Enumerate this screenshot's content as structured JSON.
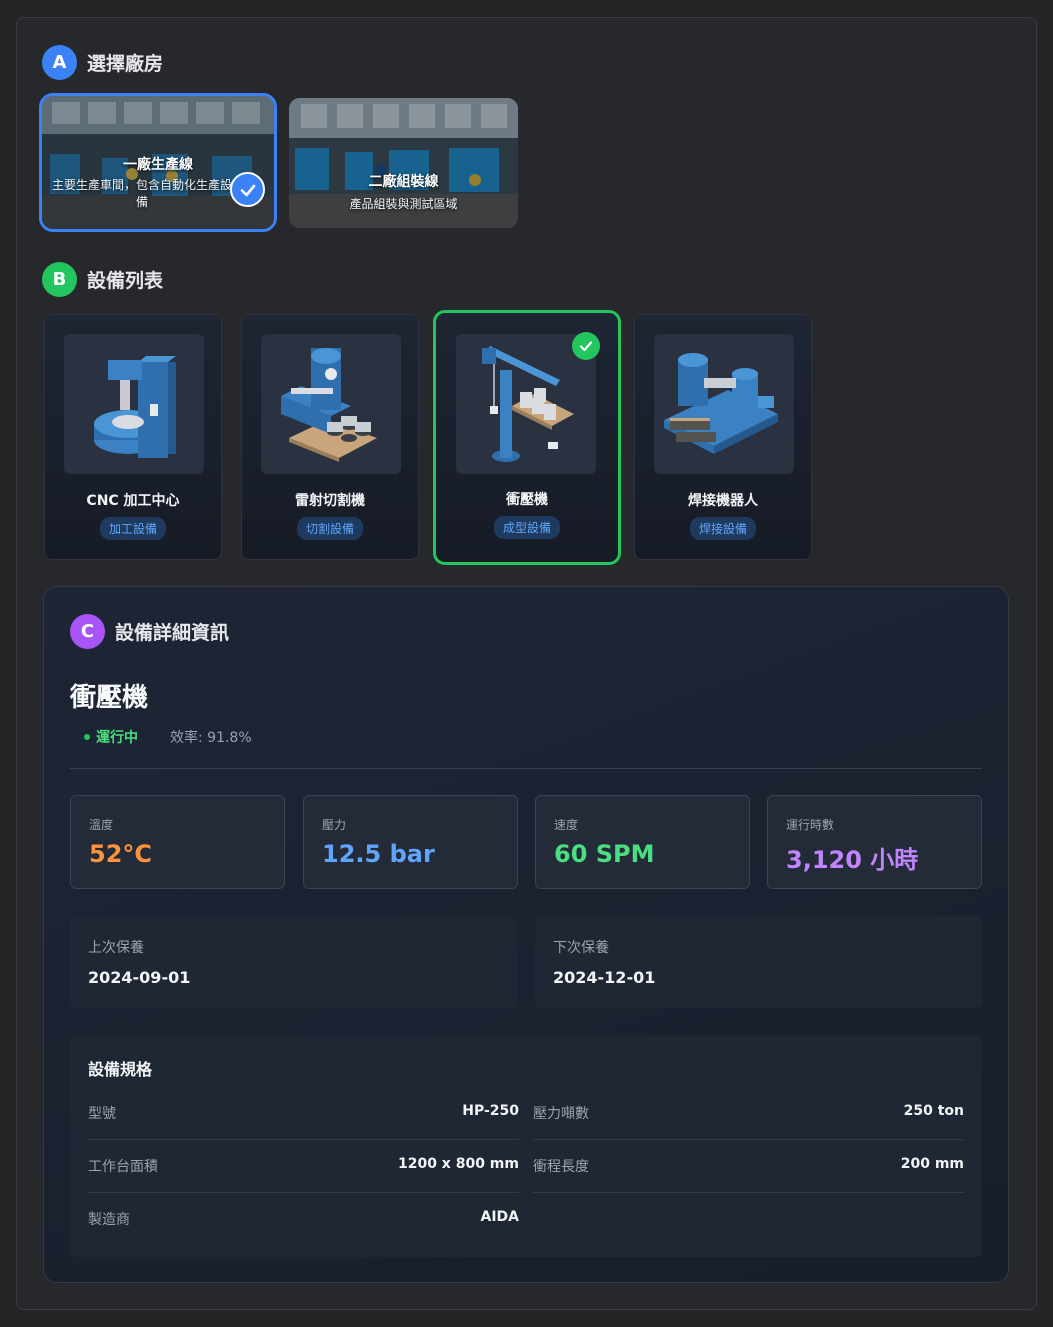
{
  "section_a": {
    "letter": "A",
    "title": "選擇廠房",
    "color": "#3b82f6"
  },
  "factories": [
    {
      "name": "一廠生產線",
      "desc": "主要生產車間，包含自動化生產設備",
      "selected": true
    },
    {
      "name": "二廠組裝線",
      "desc": "產品組裝與測試區域",
      "selected": false
    }
  ],
  "section_b": {
    "letter": "B",
    "title": "設備列表",
    "color": "#22c55e"
  },
  "equipment": [
    {
      "name": "CNC 加工中心",
      "category": "加工設備",
      "icon": "cnc-machine-icon",
      "selected": false
    },
    {
      "name": "雷射切割機",
      "category": "切割設備",
      "icon": "laser-cutter-icon",
      "selected": false
    },
    {
      "name": "衝壓機",
      "category": "成型設備",
      "icon": "press-machine-icon",
      "selected": true
    },
    {
      "name": "焊接機器人",
      "category": "焊接設備",
      "icon": "welding-robot-icon",
      "selected": false
    }
  ],
  "section_c": {
    "letter": "C",
    "title": "設備詳細資訊",
    "color": "#a855f7"
  },
  "detail": {
    "name": "衝壓機",
    "status": "運行中",
    "efficiency": "效率: 91.8%",
    "metrics": [
      {
        "label": "溫度",
        "value": "52°C",
        "color": "#fb923c"
      },
      {
        "label": "壓力",
        "value": "12.5 bar",
        "color": "#60a5fa"
      },
      {
        "label": "速度",
        "value": "60 SPM",
        "color": "#4ade80"
      },
      {
        "label": "運行時數",
        "value": "3,120 小時",
        "color": "#c084fc"
      }
    ],
    "maintenance": {
      "last_label": "上次保養",
      "last_value": "2024-09-01",
      "next_label": "下次保養",
      "next_value": "2024-12-01"
    },
    "specs": {
      "title": "設備規格",
      "rows": [
        {
          "key": "型號",
          "value": "HP-250"
        },
        {
          "key": "壓力噸數",
          "value": "250 ton"
        },
        {
          "key": "工作台面積",
          "value": "1200 x 800 mm"
        },
        {
          "key": "衝程長度",
          "value": "200 mm"
        },
        {
          "key": "製造商",
          "value": "AIDA"
        }
      ]
    }
  }
}
